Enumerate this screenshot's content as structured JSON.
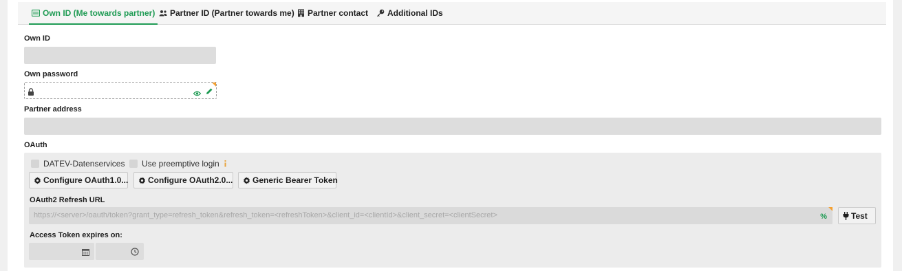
{
  "tabs": [
    {
      "label": "Own ID (Me towards partner)",
      "icon": "id-card-icon",
      "active": true
    },
    {
      "label": "Partner ID (Partner towards me)",
      "icon": "users-icon",
      "active": false
    },
    {
      "label": "Partner contact",
      "icon": "building-icon",
      "active": false
    },
    {
      "label": "Additional IDs",
      "icon": "key-icon",
      "active": false
    }
  ],
  "own_id": {
    "label": "Own ID",
    "value": ""
  },
  "own_password": {
    "label": "Own password",
    "value": ""
  },
  "partner_address": {
    "label": "Partner address",
    "value": ""
  },
  "oauth": {
    "label": "OAuth",
    "datev_label": "DATEV-Datenservices",
    "datev_checked": false,
    "preemptive_label": "Use preemptive login",
    "preemptive_checked": false,
    "buttons": {
      "oauth1": "Configure OAuth1.0...",
      "oauth2": "Configure OAuth2.0...",
      "bearer": "Generic Bearer Token"
    },
    "refresh_url_label": "OAuth2 Refresh URL",
    "refresh_url_placeholder": "https://<server>/oauth/token?grant_type=refresh_token&refresh_token=<refreshToken>&client_id=<clientId>&client_secret=<clientSecret>",
    "test_label": "Test",
    "expires_label": "Access Token expires on:",
    "expires_date": "",
    "expires_time": ""
  },
  "colors": {
    "accent": "#1f9b54",
    "marker": "#f5a030",
    "info": "#e8a33c"
  }
}
